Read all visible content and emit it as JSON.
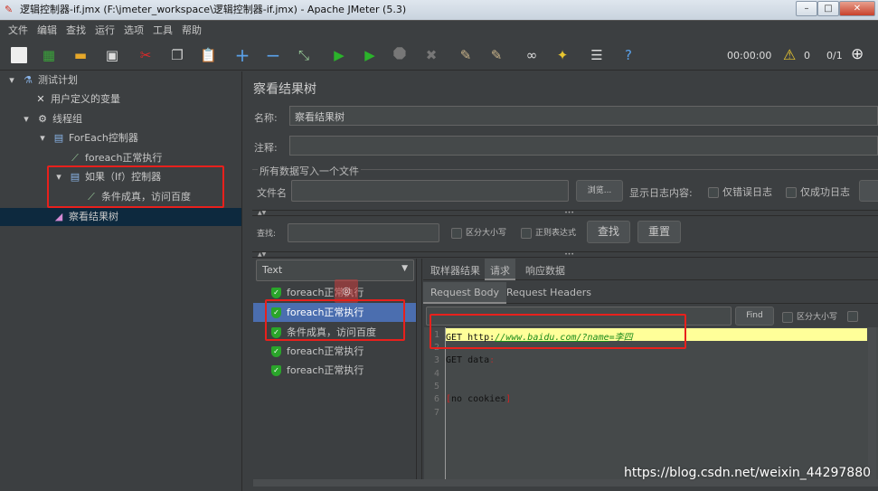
{
  "window": {
    "title": "逻辑控制器-if.jmx (F:\\jmeter_workspace\\逻辑控制器-if.jmx) - Apache JMeter (5.3)"
  },
  "menu": [
    "文件",
    "编辑",
    "查找",
    "运行",
    "选项",
    "工具",
    "帮助"
  ],
  "toolbar": {
    "timer": "00:00:00",
    "warnings": "0",
    "threads": "0/1"
  },
  "tree": [
    {
      "label": "测试计划",
      "icon": "flask-icon"
    },
    {
      "label": "用户定义的变量",
      "icon": "tools-icon"
    },
    {
      "label": "线程组",
      "icon": "gear-icon"
    },
    {
      "label": "ForEach控制器",
      "icon": "controller-icon"
    },
    {
      "label": "foreach正常执行",
      "icon": "pipette-icon"
    },
    {
      "label": "如果（If）控制器",
      "icon": "controller-icon"
    },
    {
      "label": "条件成真，访问百度",
      "icon": "pipette-icon"
    },
    {
      "label": "察看结果树",
      "icon": "chart-icon"
    }
  ],
  "panel": {
    "title": "察看结果树",
    "name_label": "名称:",
    "name_value": "察看结果树",
    "comment_label": "注释:",
    "file_group": "所有数据写入一个文件",
    "filename_label": "文件名",
    "browse": "浏览...",
    "log_label": "显示日志内容:",
    "errors_only": "仅错误日志",
    "success_only": "仅成功日志",
    "search_label": "查找:",
    "case_sensitive": "区分大小写",
    "regex": "正则表达式",
    "find": "查找",
    "reset": "重置",
    "renderer": "Text",
    "results": [
      "foreach正常执行",
      "foreach正常执行",
      "条件成真，访问百度",
      "foreach正常执行",
      "foreach正常执行"
    ],
    "tabs": [
      "取样器结果",
      "请求",
      "响应数据"
    ],
    "subtabs": [
      "Request Body",
      "Request Headers"
    ],
    "find_button": "Find",
    "find_case": "区分大小写",
    "code": {
      "l1_get": "GET http:",
      "l1_url": "//www.baidu.com/?name",
      "l1_eq": "=",
      "l1_val": "李四",
      "l3": "GET data",
      "l3_colon": ":",
      "l6_open": "[",
      "l6": "no cookies",
      "l6_close": "]"
    },
    "line_numbers": [
      "1",
      "2",
      "3",
      "4",
      "5",
      "6",
      "7"
    ]
  },
  "watermark": "https://blog.csdn.net/weixin_44297880"
}
